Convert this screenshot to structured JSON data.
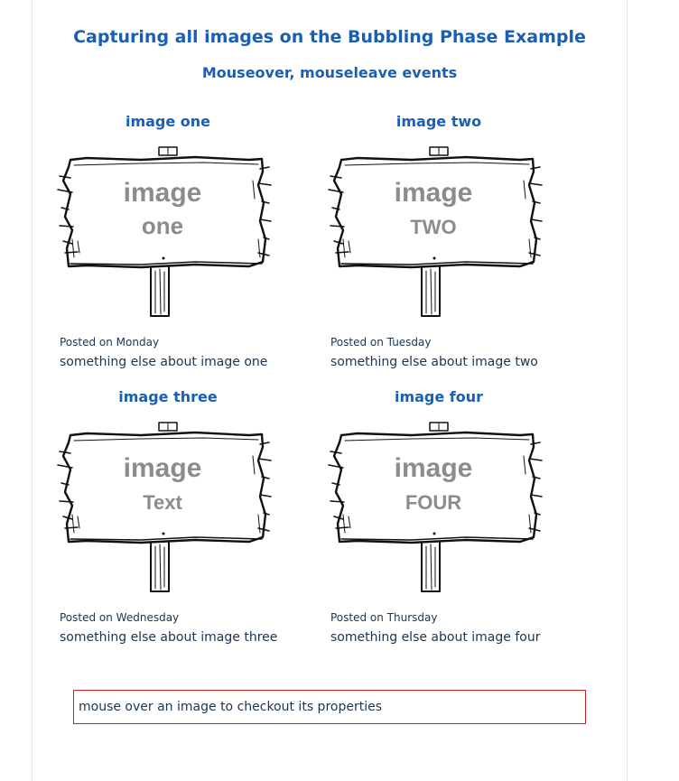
{
  "header": {
    "title": "Capturing all images on the Bubbling Phase Example",
    "subtitle": "Mouseover, mouseleave events"
  },
  "cards": [
    {
      "title": "image one",
      "image_line1": "image",
      "image_line2": "one",
      "posted": "Posted on Monday",
      "description": "something else about image one"
    },
    {
      "title": "image two",
      "image_line1": "image",
      "image_line2": "TWO",
      "posted": "Posted on Tuesday",
      "description": "something else about image two"
    },
    {
      "title": "image three",
      "image_line1": "image",
      "image_line2": "Text",
      "posted": "Posted on Wednesday",
      "description": "something else about image three"
    },
    {
      "title": "image four",
      "image_line1": "image",
      "image_line2": "FOUR",
      "posted": "Posted on Thursday",
      "description": "something else about image four"
    }
  ],
  "status": {
    "message": "mouse over an image to checkout its properties"
  },
  "colors": {
    "heading": "#1a5fb4",
    "status_border": "#c8231e",
    "image_text": "#8c8c8c"
  }
}
